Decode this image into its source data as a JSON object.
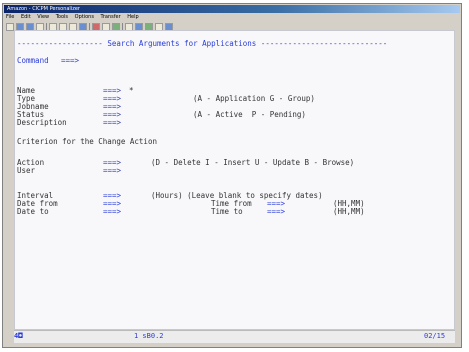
{
  "window": {
    "title": "Amazon - CICPM Personalizer",
    "menu": [
      "File",
      "Edit",
      "View",
      "Tools",
      "Options",
      "Transfer",
      "Help"
    ]
  },
  "screen": {
    "header_prefix": "-------------------",
    "header_title": "Search Arguments for Applications",
    "header_suffix": "----------------------------",
    "command_label": "Command",
    "command_arrow": "===>",
    "fields": [
      {
        "label": "Name",
        "arrow": "===>",
        "value": "*",
        "hint": ""
      },
      {
        "label": "Type",
        "arrow": "===>",
        "value": "",
        "hint": "(A - Application G - Group)"
      },
      {
        "label": "Jobname",
        "arrow": "===>",
        "value": "",
        "hint": ""
      },
      {
        "label": "Status",
        "arrow": "===>",
        "value": "",
        "hint": "(A - Active  P - Pending)"
      },
      {
        "label": "Description",
        "arrow": "===>",
        "value": "",
        "hint": ""
      }
    ],
    "criteria_heading": "Criterion for the Change Action",
    "action_label": "Action",
    "action_arrow": "===>",
    "action_hint": "(D - Delete I - Insert U - Update B - Browse)",
    "user_label": "User",
    "user_arrow": "===>",
    "interval_label": "Interval",
    "interval_arrow": "===>",
    "interval_hint": "(Hours) (Leave blank to specify dates)",
    "date_from_label": "Date from",
    "date_from_arrow": "===>",
    "time_from_label": "Time from",
    "time_from_arrow": "===>",
    "time_from_format": "(HH,MM)",
    "date_to_label": "Date to",
    "date_to_arrow": "===>",
    "time_to_label": "Time to",
    "time_to_arrow": "===>",
    "time_to_format": "(HH,MM)"
  },
  "statusbar": {
    "indicator": "4◘",
    "session": "1 sB0.2",
    "cursor": "02/15"
  }
}
